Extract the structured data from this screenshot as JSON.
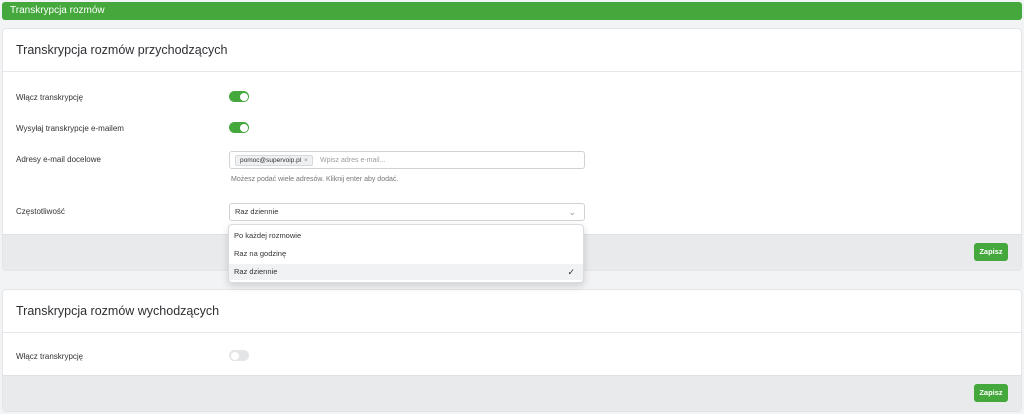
{
  "topbar": {
    "title": "Transkrypcja rozmów"
  },
  "incoming": {
    "title": "Transkrypcja rozmów przychodzących",
    "enable_label": "Włącz transkrypcję",
    "enable_on": true,
    "email_label": "Wysyłaj transkrypcje e-mailem",
    "email_on": true,
    "addresses_label": "Adresy e-mail docelowe",
    "email_chip": "pomoc@supervoip.pl",
    "email_chip_remove": "×",
    "email_placeholder": "Wpisz adres e-mail...",
    "hint": "Możesz podać wiele adresów. Kliknij enter aby dodać.",
    "frequency_label": "Częstotliwość",
    "frequency_value": "Raz dziennie",
    "frequency_options": [
      "Po każdej rozmowie",
      "Raz na godzinę",
      "Raz dziennie"
    ],
    "save_label": "Zapisz"
  },
  "outgoing": {
    "title": "Transkrypcja rozmów wychodzących",
    "enable_label": "Włącz transkrypcję",
    "enable_on": false,
    "save_label": "Zapisz"
  },
  "icons": {
    "chevron": "chevron-down-icon",
    "check": "check-icon",
    "remove": "close-icon"
  },
  "colors": {
    "accent": "#44a83c",
    "footer": "#e9eaec"
  }
}
